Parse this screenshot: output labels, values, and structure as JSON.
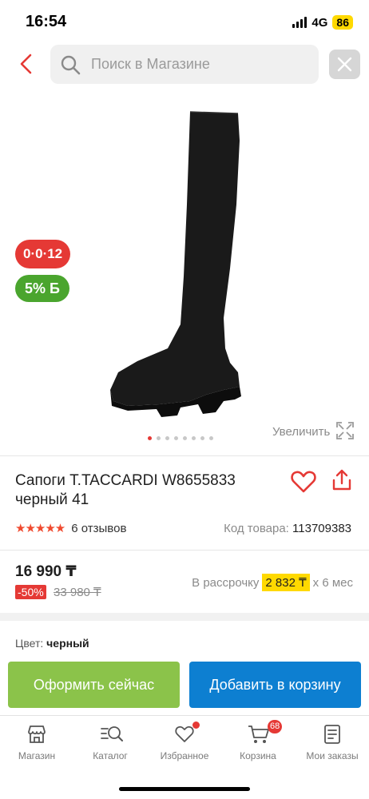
{
  "status_bar": {
    "time": "16:54",
    "network": "4G",
    "battery": "86"
  },
  "header": {
    "search_placeholder": "Поиск в Магазине",
    "icons": [
      "chevron-left-icon",
      "search-icon",
      "close-icon"
    ]
  },
  "gallery": {
    "timer_badge": "0·0·12",
    "bonus_badge": "5% Б",
    "zoom_label": "Увеличить",
    "image_count": 8,
    "active_index": 0
  },
  "product": {
    "title": "Сапоги T.TACCARDI W8655833 черный 41",
    "rating": 5,
    "reviews": "6 отзывов",
    "code_label": "Код товара:",
    "code_value": "113709383"
  },
  "price": {
    "current": "16 990 ₸",
    "discount": "-50%",
    "old": "33 980 ₸",
    "installment_prefix": "В рассрочку",
    "installment_amount": "2 832 ₸",
    "installment_suffix": "х 6 мес"
  },
  "options": {
    "color_label": "Цвет:",
    "color_value": "черный"
  },
  "actions": {
    "buy_now": "Оформить сейчас",
    "add_to_cart": "Добавить в корзину"
  },
  "nav": {
    "items": [
      {
        "label": "Магазин",
        "icon": "shop-icon"
      },
      {
        "label": "Каталог",
        "icon": "catalog-search-icon"
      },
      {
        "label": "Избранное",
        "icon": "heart-icon"
      },
      {
        "label": "Корзина",
        "icon": "cart-icon"
      },
      {
        "label": "Мои заказы",
        "icon": "orders-icon"
      }
    ],
    "cart_count": "68"
  },
  "colors": {
    "accent_red": "#e53935",
    "buy_green": "#8bc34a",
    "cart_blue": "#0d7fd1",
    "installment_yellow": "#ffd900"
  }
}
